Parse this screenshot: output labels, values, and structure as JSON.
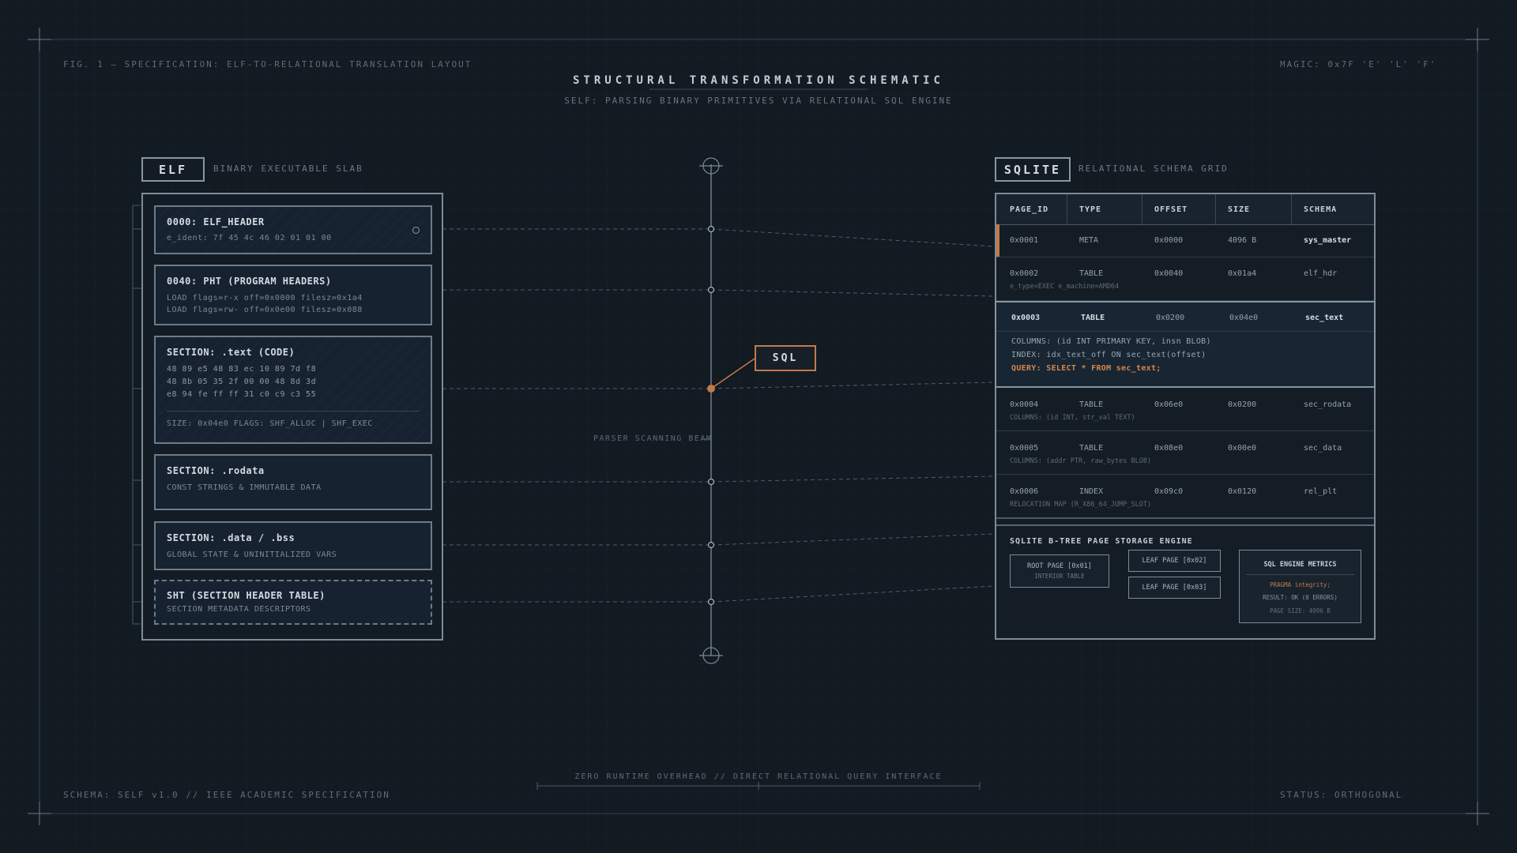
{
  "header": {
    "fig_label": "FIG. 1 — SPECIFICATION: ELF-TO-RELATIONAL TRANSLATION LAYOUT",
    "magic": "MAGIC: 0x7F 'E' 'L' 'F'",
    "title": "STRUCTURAL TRANSFORMATION SCHEMATIC",
    "subtitle": "SELF: PARSING BINARY PRIMITIVES VIA RELATIONAL SQL ENGINE"
  },
  "elf": {
    "tag": "ELF",
    "label": "BINARY EXECUTABLE SLAB",
    "header_box": {
      "title": "0000: ELF_HEADER",
      "line": "e_ident: 7f 45 4c 46 02 01 01 00"
    },
    "pht_box": {
      "title": "0040: PHT (PROGRAM HEADERS)",
      "line1": "LOAD flags=r-x off=0x0000 filesz=0x1a4",
      "line2": "LOAD flags=rw- off=0x0e00 filesz=0x088"
    },
    "text_box": {
      "title": "SECTION: .text (CODE)",
      "hex1": "48 89 e5 48 83 ec 10 89 7d f8",
      "hex2": "48 8b 05 35 2f 00 00 48 8d 3d",
      "hex3": "e8 94 fe ff ff 31 c0 c9 c3 55",
      "footer": "SIZE: 0x04e0 FLAGS: SHF_ALLOC | SHF_EXEC"
    },
    "rodata_box": {
      "title": "SECTION: .rodata",
      "line": "CONST STRINGS & IMMUTABLE DATA"
    },
    "data_box": {
      "title": "SECTION: .data / .bss",
      "line": "GLOBAL STATE & UNINITIALIZED VARS"
    },
    "sht_box": {
      "title": "SHT (SECTION HEADER TABLE)",
      "line": "SECTION METADATA DESCRIPTORS"
    }
  },
  "center": {
    "sql_badge": "SQL",
    "beam_label": "PARSER SCANNING BEAM"
  },
  "sqlite": {
    "tag": "SQLITE",
    "label": "RELATIONAL SCHEMA GRID",
    "columns": [
      "PAGE_ID",
      "TYPE",
      "OFFSET",
      "SIZE",
      "SCHEMA"
    ],
    "rows": [
      {
        "page_id": "0x0001",
        "type": "META",
        "offset": "0x0000",
        "size": "4096 B",
        "schema": "sys_master",
        "sub": ""
      },
      {
        "page_id": "0x0002",
        "type": "TABLE",
        "offset": "0x0040",
        "size": "0x01a4",
        "schema": "elf_hdr",
        "sub": "e_type=EXEC e_machine=AMD64"
      },
      {
        "page_id": "0x0003",
        "type": "TABLE",
        "offset": "0x0200",
        "size": "0x04e0",
        "schema": "sec_text",
        "sub": ""
      },
      {
        "page_id": "0x0004",
        "type": "TABLE",
        "offset": "0x06e0",
        "size": "0x0200",
        "schema": "sec_rodata",
        "sub": "COLUMNS: (id INT, str_val TEXT)"
      },
      {
        "page_id": "0x0005",
        "type": "TABLE",
        "offset": "0x08e0",
        "size": "0x00e0",
        "schema": "sec_data",
        "sub": "COLUMNS: (addr PTR, raw_bytes BLOB)"
      },
      {
        "page_id": "0x0006",
        "type": "INDEX",
        "offset": "0x09c0",
        "size": "0x0120",
        "schema": "rel_plt",
        "sub": "RELOCATION MAP (R_X86_64_JUMP_SLOT)"
      }
    ],
    "expanded": {
      "columns": "COLUMNS: (id INT PRIMARY KEY, insn BLOB)",
      "index": "INDEX: idx_text_off ON sec_text(offset)",
      "query": "QUERY: SELECT * FROM sec_text;"
    },
    "engine": {
      "title": "SQLITE B-TREE PAGE STORAGE ENGINE",
      "root": "ROOT PAGE [0x01]",
      "root_sub": "INTERIOR TABLE",
      "leaf1": "LEAF PAGE [0x02]",
      "leaf2": "LEAF PAGE [0x03]",
      "metrics_title": "SQL ENGINE METRICS",
      "metrics_line1": "PRAGMA integrity;",
      "metrics_line2": "RESULT: OK (0 ERRORS)",
      "metrics_line3": "PAGE SIZE: 4096 B"
    }
  },
  "footer": {
    "left": "SCHEMA: SELF v1.0 // IEEE ACADEMIC SPECIFICATION",
    "center": "ZERO RUNTIME OVERHEAD // DIRECT RELATIONAL QUERY INTERFACE",
    "right": "STATUS: ORTHOGONAL"
  },
  "colors": {
    "accent": "#c27a48",
    "background": "#121a22",
    "line": "#7d8b98"
  }
}
